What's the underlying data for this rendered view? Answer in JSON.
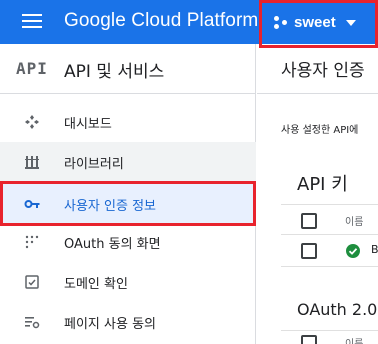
{
  "topbar": {
    "brand": "Google Cloud Platform",
    "project": "sweet"
  },
  "sidenav": {
    "logo": "API",
    "title": "API 및 서비스",
    "items": [
      {
        "label": "대시보드",
        "icon": "dashboard-icon"
      },
      {
        "label": "라이브러리",
        "icon": "library-icon"
      },
      {
        "label": "사용자 인증 정보",
        "icon": "key-icon"
      },
      {
        "label": "OAuth 동의 화면",
        "icon": "consent-icon"
      },
      {
        "label": "도메인 확인",
        "icon": "domain-check-icon"
      },
      {
        "label": "페이지 사용 동의",
        "icon": "page-consent-icon"
      }
    ]
  },
  "main": {
    "title": "사용자 인증",
    "description": "사용 설정한 API에",
    "api_keys": {
      "heading": "API 키",
      "column_name": "이름",
      "row_text": "B"
    },
    "oauth": {
      "heading": "OAuth 2.0",
      "column_name": "이름"
    }
  },
  "colors": {
    "appbar": "#1a73e8",
    "selected_bg": "#e8f0fe",
    "selected_text": "#1967d2",
    "annotation": "#e8232d",
    "ok_green": "#1e8e3e"
  }
}
